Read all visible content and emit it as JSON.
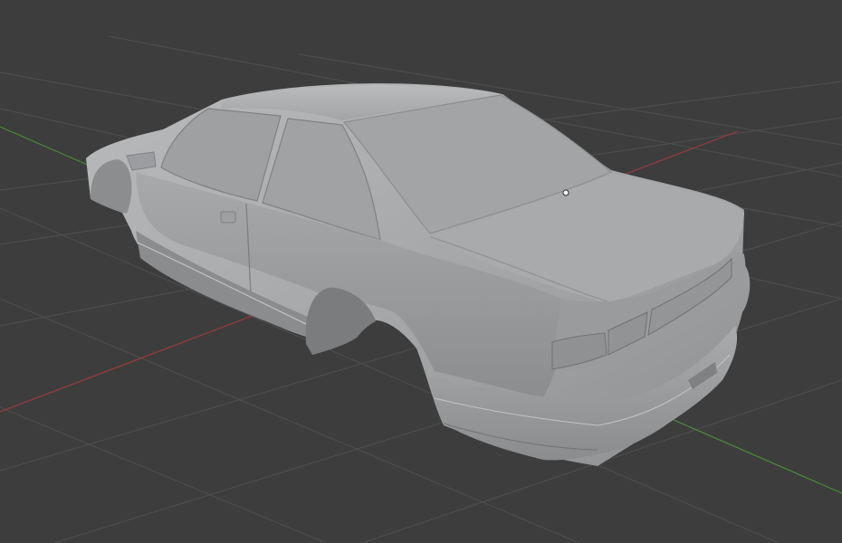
{
  "viewport": {
    "background": "#3d3d3d",
    "grid_color": "#4f4f4f",
    "x_axis_color": "#9b3b3b",
    "y_axis_color": "#4c8a3a"
  },
  "scene": {
    "object": "car-body-shell",
    "material_color": "#a9abad",
    "shading": "solid"
  }
}
